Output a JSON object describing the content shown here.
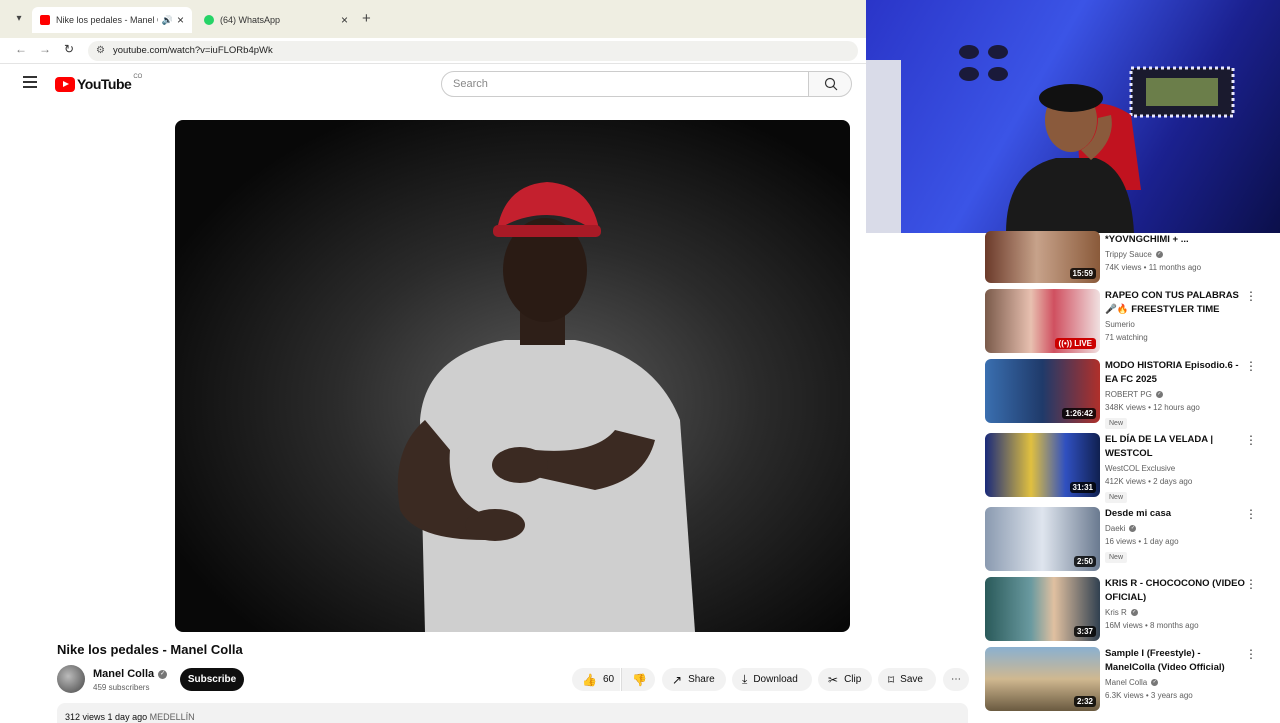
{
  "browser": {
    "tabs": [
      {
        "title": "Nike los pedales - Manel Co",
        "active": true,
        "favicon_color": "#ff0000"
      },
      {
        "title": "(64) WhatsApp",
        "active": false,
        "favicon_color": "#25d366"
      }
    ],
    "url": "youtube.com/watch?v=iuFLORb4pWk"
  },
  "header": {
    "logo_text": "YouTube",
    "country_code": "CO",
    "search_placeholder": "Search"
  },
  "video": {
    "title": "Nike los pedales - Manel Colla",
    "channel": "Manel Colla",
    "subscribers": "459 subscribers",
    "subscribe_label": "Subscribe",
    "likes": "60",
    "share_label": "Share",
    "download_label": "Download",
    "clip_label": "Clip",
    "save_label": "Save",
    "views": "312 views",
    "age": "1 day ago",
    "location": "MEDELLÍN"
  },
  "recommendations": [
    {
      "title": "*YOVNGCHIMI + ...",
      "channel": "Trippy Sauce",
      "verified": true,
      "stats": "74K views • 11 months ago",
      "duration": "15:59",
      "live": false,
      "new": false
    },
    {
      "title": "RAPEO CON TUS PALABRAS 🎤🔥 FREESTYLER TIME",
      "channel": "Sumerio",
      "verified": false,
      "stats": "71 watching",
      "duration": "",
      "live": true,
      "new": false
    },
    {
      "title": "MODO HISTORIA Episodio.6 - EA FC 2025",
      "channel": "ROBERT PG",
      "verified": true,
      "stats": "348K views • 12 hours ago",
      "duration": "1:26:42",
      "live": false,
      "new": true
    },
    {
      "title": "EL DÍA DE LA VELADA | WESTCOL",
      "channel": "WestCOL Exclusive",
      "verified": false,
      "stats": "412K views • 2 days ago",
      "duration": "31:31",
      "live": false,
      "new": true
    },
    {
      "title": "Desde mi casa",
      "channel": "Daeki",
      "verified": true,
      "stats": "16 views • 1 day ago",
      "duration": "2:50",
      "live": false,
      "new": true
    },
    {
      "title": "KRIS R - CHOCOCONO  (VIDEO OFICIAL)",
      "channel": "Kris R",
      "verified": true,
      "stats": "16M views • 8 months ago",
      "duration": "3:37",
      "live": false,
      "new": false
    },
    {
      "title": "Sample I (Freestyle) - ManelColla (Video Official)",
      "channel": "Manel Colla",
      "verified": true,
      "stats": "6.3K views • 3 years ago",
      "duration": "2:32",
      "live": false,
      "new": false
    }
  ],
  "icons": {
    "tab_list": "chevron-down-icon",
    "speaker": "speaker-icon",
    "like": "thumbs-up-icon",
    "dislike": "thumbs-down-icon",
    "share": "share-icon",
    "download": "download-icon",
    "clip": "scissors-icon",
    "save": "bookmark-icon",
    "more": "more-vert-icon"
  },
  "colors": {
    "brand_red": "#ff0000",
    "subscribe_bg": "#0f0f0f",
    "live_badge": "#cc0000",
    "tabbar_bg": "#efeee2"
  }
}
